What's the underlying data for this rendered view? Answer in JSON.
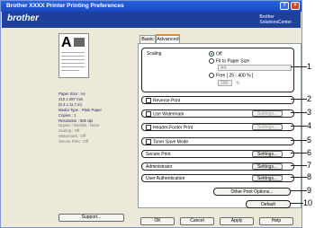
{
  "title": "Brother XXXX   Printer Printing Preferences",
  "brand": "brother",
  "solutions_center": [
    "Brother",
    "SolutionsCenter"
  ],
  "tabs": [
    {
      "label": "Basic"
    },
    {
      "label": "Advanced"
    }
  ],
  "info": {
    "paper_size": "Paper Size : A4",
    "dims1": "210 x 297 mm",
    "dims2": "(8.3 x 11.7 in)",
    "media": "Media Type : Plain Paper",
    "copies": "Copies : 1",
    "resolution": "Resolution : 600 dpi",
    "duplex": "Duplex / Booklet : None",
    "scaling": "Scaling : Off",
    "watermark": "Watermark : Off",
    "secure": "Secure Print : Off"
  },
  "support_label": "Support...",
  "scaling": {
    "label": "Scaling",
    "off": "Off",
    "fit": "Fit to Paper Size",
    "paper_value": "A4",
    "free": "Free [ 25 - 400 % ]",
    "free_value": "100",
    "free_unit": "%"
  },
  "options": {
    "reverse": "Reverse Print",
    "watermark": "Use Watermark",
    "header": "Header-Footer Print",
    "toner": "Toner Save Mode",
    "secure": "Secure Print",
    "admin": "Administrator",
    "userauth": "User Authentication"
  },
  "settings_label": "Settings...",
  "other_options": "Other Print Options...",
  "default_label": "Default",
  "footer": {
    "ok": "OK",
    "cancel": "Cancel",
    "apply": "Apply",
    "help": "Help"
  },
  "callouts": [
    "1",
    "2",
    "3",
    "4",
    "5",
    "6",
    "7",
    "8",
    "9",
    "10"
  ]
}
